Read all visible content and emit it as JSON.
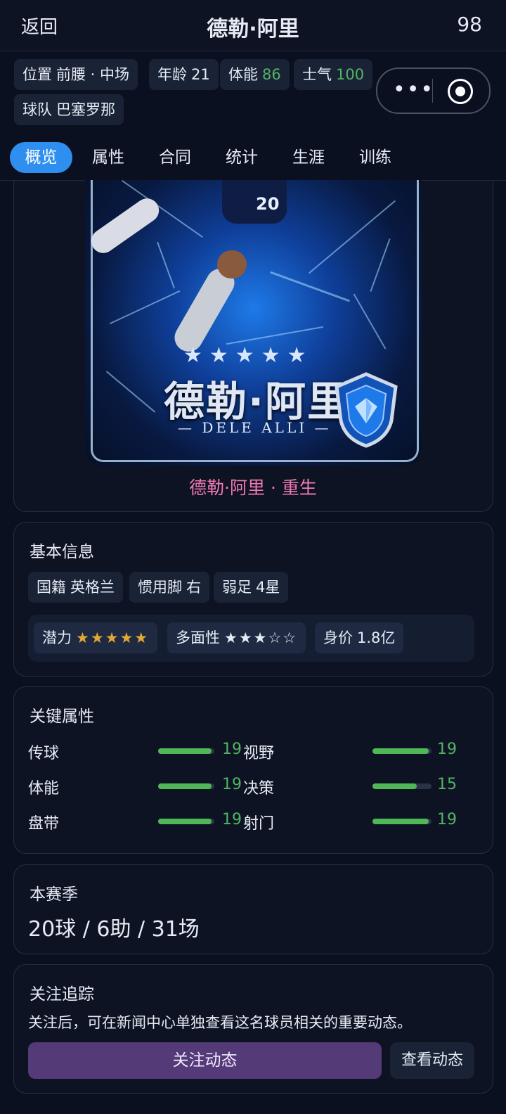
{
  "header": {
    "back_label": "返回",
    "title": "德勒·阿里",
    "rating": "98"
  },
  "info_pills": {
    "position_label": "位置",
    "position_value": "前腰 · 中场",
    "age_label": "年龄",
    "age_value": "21",
    "stamina_label": "体能",
    "stamina_value": "86",
    "morale_label": "士气",
    "morale_value": "100",
    "team_label": "球队",
    "team_value": "巴塞罗那"
  },
  "capsule": {
    "more_icon": "more-dots-icon",
    "target_icon": "record-circle-icon"
  },
  "tabs": [
    "概览",
    "属性",
    "合同",
    "统计",
    "生涯",
    "训练"
  ],
  "active_tab": 0,
  "player_card": {
    "stars": "★★★★★",
    "name_cn": "德勒·阿里",
    "name_en": "— DELE ALLI —",
    "shirt_number": "20",
    "edition_label": "德勒·阿里 · 重生",
    "colors": {
      "accent": "#1e7ae8",
      "edition": "#f07ab4"
    }
  },
  "basic_info": {
    "title": "基本信息",
    "nationality_label": "国籍",
    "nationality_value": "英格兰",
    "foot_label": "惯用脚",
    "foot_value": "右",
    "weak_foot_label": "弱足",
    "weak_foot_value": "4星",
    "potential_label": "潜力",
    "potential_stars": "★★★★★",
    "versatility_label": "多面性",
    "versatility_stars": "★★★☆☆",
    "value_label": "身价",
    "value_value": "1.8亿"
  },
  "key_attributes": {
    "title": "关键属性",
    "max": 20,
    "left": [
      {
        "label": "传球",
        "value": 19
      },
      {
        "label": "体能",
        "value": 19
      },
      {
        "label": "盘带",
        "value": 19
      }
    ],
    "right": [
      {
        "label": "视野",
        "value": 19
      },
      {
        "label": "决策",
        "value": 15
      },
      {
        "label": "射门",
        "value": 19
      }
    ]
  },
  "season": {
    "title": "本赛季",
    "summary": "20球 / 6助 / 31场"
  },
  "follow": {
    "title": "关注追踪",
    "description": "关注后，可在新闻中心单独查看这名球员相关的重要动态。",
    "follow_button": "关注动态",
    "view_button": "查看动态"
  }
}
